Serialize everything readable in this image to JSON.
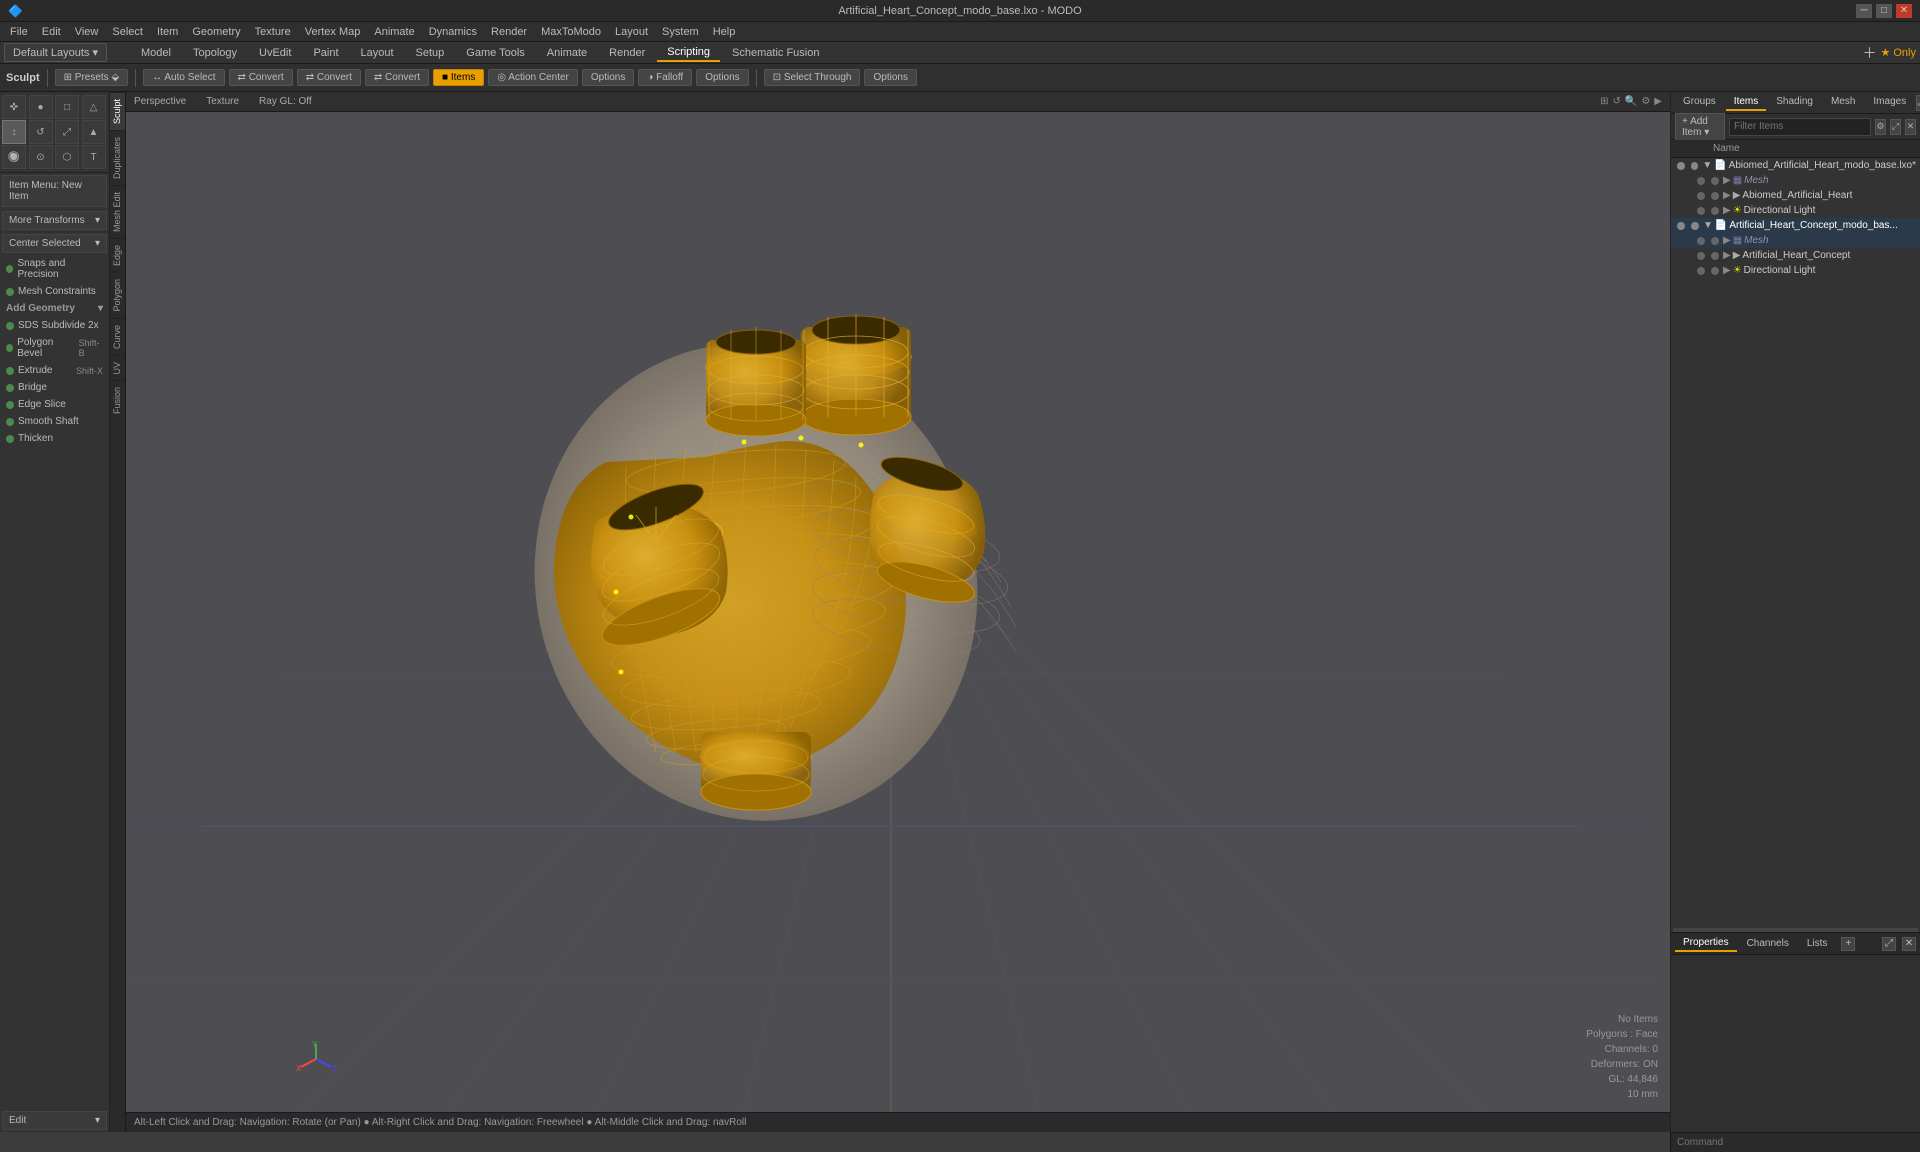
{
  "titlebar": {
    "title": "Artificial_Heart_Concept_modo_base.lxo - MODO",
    "minimize": "─",
    "maximize": "□",
    "close": "✕"
  },
  "menubar": {
    "items": [
      "File",
      "Edit",
      "View",
      "Select",
      "Item",
      "Geometry",
      "Texture",
      "Vertex Map",
      "Animate",
      "Dynamics",
      "Render",
      "MaxToModo",
      "Layout",
      "System",
      "Help"
    ]
  },
  "layoutbar": {
    "default_layout": "Default Layouts",
    "tabs": [
      "Model",
      "Topology",
      "UvEdit",
      "Paint",
      "Layout",
      "Setup",
      "Game Tools",
      "Animate",
      "Render",
      "Scripting",
      "Schematic Fusion"
    ],
    "star_only": "★  Only"
  },
  "sculpt_bar": {
    "sculpt_label": "Sculpt",
    "presets_label": "Presets",
    "buttons": [
      {
        "label": "Auto Select",
        "icon": "🔲",
        "active": false
      },
      {
        "label": "Convert",
        "active": false
      },
      {
        "label": "Convert",
        "active": false
      },
      {
        "label": "Convert",
        "active": false
      },
      {
        "label": "Items",
        "active": true
      },
      {
        "label": "Action Center",
        "active": false
      },
      {
        "label": "Options",
        "active": false
      },
      {
        "label": "Falloff",
        "active": false
      },
      {
        "label": "Options",
        "active": false
      },
      {
        "label": "Select Through",
        "active": false
      },
      {
        "label": "Options",
        "active": false
      }
    ]
  },
  "left_panel": {
    "item_menu": "Item Menu: New Item",
    "transforms": {
      "more_transforms": "More Transforms",
      "center_selected": "Center Selected"
    },
    "snap_tools": [
      {
        "label": "Snaps and Precision",
        "dot_color": "#4a8a4a"
      },
      {
        "label": "Mesh Constraints",
        "dot_color": "#4a8a4a"
      }
    ],
    "add_geometry": {
      "title": "Add Geometry",
      "items": [
        {
          "label": "SDS Subdivide 2x",
          "dot_color": "#4a8a4a",
          "shortcut": ""
        },
        {
          "label": "Polygon Bevel",
          "dot_color": "#4a8a4a",
          "shortcut": "Shift-B"
        },
        {
          "label": "Extrude",
          "dot_color": "#4a8a4a",
          "shortcut": "Shift-X"
        },
        {
          "label": "Bridge",
          "dot_color": "#4a8a4a",
          "shortcut": ""
        },
        {
          "label": "Edge Slice",
          "dot_color": "#4a8a4a",
          "shortcut": ""
        },
        {
          "label": "Smooth Shaft",
          "dot_color": "#4a8a4a",
          "shortcut": ""
        },
        {
          "label": "Thicken",
          "dot_color": "#4a8a4a",
          "shortcut": ""
        }
      ]
    },
    "edit": {
      "label": "Edit"
    },
    "side_tabs": [
      "Sculpt",
      "Duplicates",
      "Mesh Edit",
      "Edge",
      "Polygon",
      "Curve",
      "UV",
      "Fusion"
    ]
  },
  "viewport": {
    "view_type": "Perspective",
    "texture": "Texture",
    "ray": "Ray GL: Off",
    "stats": {
      "no_items": "No Items",
      "polygons": "Polygons : Face",
      "channels": "Channels: 0",
      "deformers": "Deformers: ON",
      "gl_detail": "GL: 44,846",
      "unit": "10 mm"
    }
  },
  "statusbar": {
    "text": "Alt-Left Click and Drag: Navigation: Rotate (or Pan)  ●  Alt-Right Click and Drag: Navigation: Freewheel  ●  Alt-Middle Click and Drag: navRoll"
  },
  "right_panel": {
    "tabs": [
      "Groups",
      "Items",
      "Shading",
      "Mesh",
      "Images"
    ],
    "active_tab": "Items",
    "add_item": "Add Item",
    "filter_items": "Filter Items",
    "name_col": "Name",
    "scene_items": [
      {
        "name": "Abiomed_Artificial_Heart_modo_base.lxo*",
        "type": "file",
        "level": 0,
        "expanded": true,
        "children": [
          {
            "name": "Mesh",
            "type": "mesh",
            "level": 1,
            "expanded": false,
            "italic": true
          },
          {
            "name": "Abiomed_Artificial_Heart",
            "type": "group",
            "level": 1,
            "expanded": false
          },
          {
            "name": "Directional Light",
            "type": "light",
            "level": 1,
            "expanded": false
          }
        ]
      },
      {
        "name": "Artificial_Heart_Concept_modo_bas...",
        "type": "file",
        "level": 0,
        "expanded": true,
        "selected": true,
        "children": [
          {
            "name": "Mesh",
            "type": "mesh",
            "level": 1,
            "expanded": false,
            "italic": true
          },
          {
            "name": "Artificial_Heart_Concept",
            "type": "group",
            "level": 1,
            "expanded": false,
            "selected": true
          },
          {
            "name": "Directional Light",
            "type": "light",
            "level": 1,
            "expanded": false
          }
        ]
      }
    ],
    "bottom_tabs": [
      "Properties",
      "Channels",
      "Lists"
    ],
    "add_btn": "+",
    "expand_btn": "⤢",
    "close_btn": "✕"
  },
  "command_bar": {
    "placeholder": "Command"
  }
}
